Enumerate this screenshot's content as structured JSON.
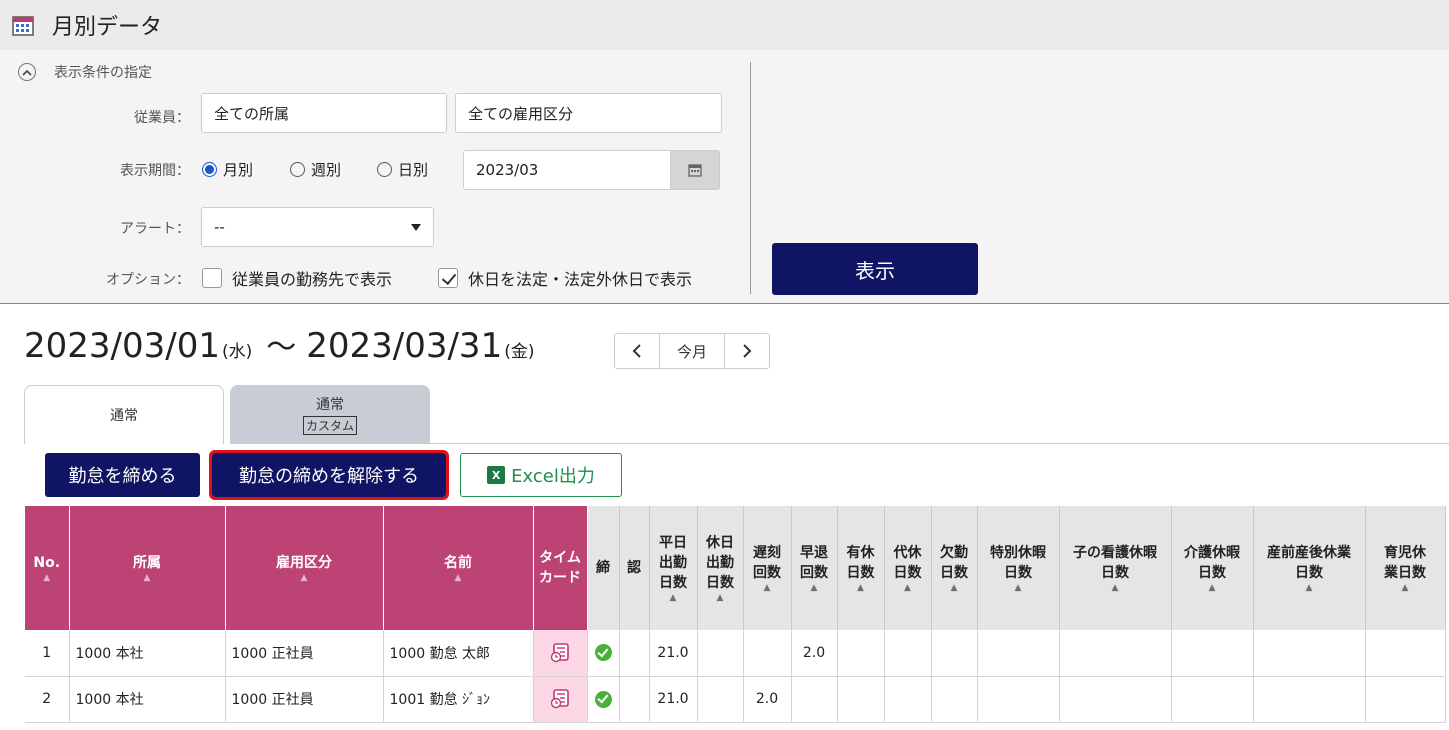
{
  "page": {
    "title": "月別データ",
    "icon": "calendar-icon"
  },
  "conditions": {
    "header": "表示条件の指定",
    "employee_label": "従業員：",
    "employee_dept": "全ての所属",
    "employee_type": "全ての雇用区分",
    "period_label": "表示期間：",
    "period_options": [
      "月別",
      "週別",
      "日別"
    ],
    "period_selected": "月別",
    "date_value": "2023/03",
    "alert_label": "アラート：",
    "alert_value": "--",
    "option_label": "オプション：",
    "option1": "従業員の勤務先で表示",
    "option1_checked": false,
    "option2": "休日を法定・法定外休日で表示",
    "option2_checked": true,
    "show_button": "表示"
  },
  "range": {
    "start_date": "2023/03/01",
    "start_weekday": "(水)",
    "tilde": "〜",
    "end_date": "2023/03/31",
    "end_weekday": "(金)",
    "this_month": "今月"
  },
  "tabs": [
    {
      "label": "通常",
      "active": true
    },
    {
      "label": "通常",
      "sub": "カスタム",
      "active": false
    }
  ],
  "actions": {
    "close": "勤怠を締める",
    "unclose": "勤怠の締めを解除する",
    "excel": "Excel出力"
  },
  "table": {
    "headers": [
      {
        "label": "No.",
        "sortable": true
      },
      {
        "label": "所属",
        "sortable": true
      },
      {
        "label": "雇用区分",
        "sortable": true
      },
      {
        "label": "名前",
        "sortable": true
      },
      {
        "label": "タイムカード",
        "sortable": false
      },
      {
        "label": "締",
        "sortable": false
      },
      {
        "label": "認",
        "sortable": false
      },
      {
        "label": "平日出勤日数",
        "sortable": true
      },
      {
        "label": "休日出勤日数",
        "sortable": true
      },
      {
        "label": "遅刻回数",
        "sortable": true
      },
      {
        "label": "早退回数",
        "sortable": true
      },
      {
        "label": "有休日数",
        "sortable": true
      },
      {
        "label": "代休日数",
        "sortable": true
      },
      {
        "label": "欠勤日数",
        "sortable": true
      },
      {
        "label": "特別休暇日数",
        "sortable": true
      },
      {
        "label": "子の看護休暇日数",
        "sortable": true
      },
      {
        "label": "介護休暇日数",
        "sortable": true
      },
      {
        "label": "産前産後休業日数",
        "sortable": true
      },
      {
        "label": "育児休業日数",
        "sortable": true
      }
    ],
    "rows": [
      {
        "no": "1",
        "dept": "1000 本社",
        "type": "1000 正社員",
        "name": "1000 勤怠 太郎",
        "closed": true,
        "weekday": "21.0",
        "holiday": "",
        "late": "",
        "early": "2.0"
      },
      {
        "no": "2",
        "dept": "1000 本社",
        "type": "1000 正社員",
        "name": "1001 勤怠 ｼﾞｮﾝ",
        "closed": true,
        "weekday": "21.0",
        "holiday": "",
        "late": "2.0",
        "early": ""
      }
    ]
  }
}
